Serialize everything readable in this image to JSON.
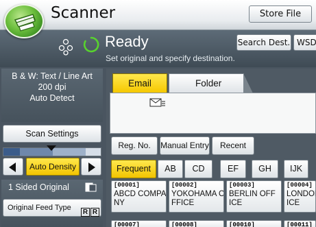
{
  "app": {
    "title": "Scanner",
    "store_file": "Store File"
  },
  "status": {
    "text": "Ready",
    "message": "Set original and specify destination."
  },
  "header_buttons": {
    "search_dest": "Search Dest.",
    "wsd": "WSD"
  },
  "scan_settings": {
    "line1": "B & W: Text / Line Art",
    "line2": "200 dpi",
    "line3": "Auto Detect",
    "button": "Scan Settings"
  },
  "density": {
    "auto_label": "Auto Density",
    "level": 0.5
  },
  "original": {
    "sided": "1 Sided Original",
    "feed_type": "Original Feed Type",
    "feed_icons": [
      "R",
      "R"
    ]
  },
  "tabs": {
    "email": "Email",
    "folder": "Folder"
  },
  "dest_buttons": {
    "reg_no": "Reg. No.",
    "manual_entry": "Manual Entry",
    "recent": "Recent"
  },
  "index_tabs": [
    "Frequent",
    "AB",
    "CD",
    "EF",
    "GH",
    "IJK"
  ],
  "entries": [
    {
      "number": "[00001]",
      "line1": "ABCD COMPA",
      "line2": "NY"
    },
    {
      "number": "[00002]",
      "line1": "YOKOHAMA O",
      "line2": "FFICE"
    },
    {
      "number": "[00003]",
      "line1": "BERLIN OFF",
      "line2": "ICE"
    },
    {
      "number": "[00004]",
      "line1": "LONDON",
      "line2": "ICE"
    }
  ],
  "entries_row2": [
    "[00007]",
    "[00008]",
    "[00010]",
    "[00011]"
  ]
}
